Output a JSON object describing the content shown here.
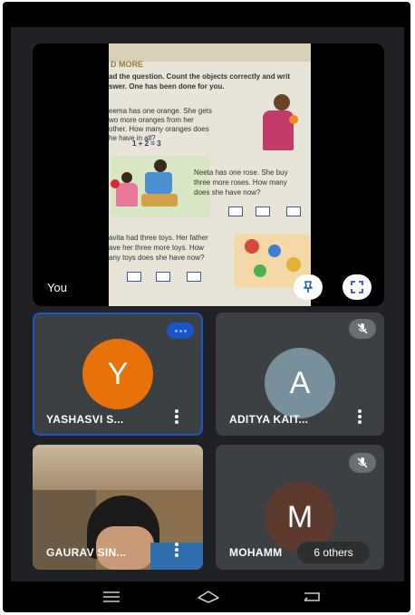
{
  "main_tile": {
    "label": "You",
    "book": {
      "heading": "D MORE",
      "instruction_1": "ad the question. Count the objects correctly and writ",
      "instruction_2": "swer. One has been done for you.",
      "q1_l1": "eema has one orange. She gets",
      "q1_l2": "wo more oranges from her",
      "q1_l3": "other. How many oranges does",
      "q1_l4": "he have in all?",
      "q1_sum": "1 + 2 = 3",
      "q2_l1": "Neeta has one rose. She buy",
      "q2_l2": "three more roses. How many",
      "q2_l3": "does she have now?",
      "q3_l1": "avita had three toys. Her father",
      "q3_l2": "ave her three more toys. How",
      "q3_l3": "any toys does she have now?"
    }
  },
  "participants": [
    {
      "name": "YASHASVI S...",
      "initial": "Y",
      "color": "#e8710a",
      "status": "speaking"
    },
    {
      "name": "ADITYA KAIT...",
      "initial": "A",
      "color": "#78909c",
      "status": "muted"
    },
    {
      "name": "GAURAV SIN...",
      "status": "video"
    },
    {
      "name": "MOHAMM",
      "initial": "M",
      "color": "#5d3a2e",
      "status": "muted"
    }
  ],
  "others_label": "6 others",
  "colors": {
    "background": "#202124",
    "tile": "#3c4043",
    "active_border": "#1a56c8"
  }
}
